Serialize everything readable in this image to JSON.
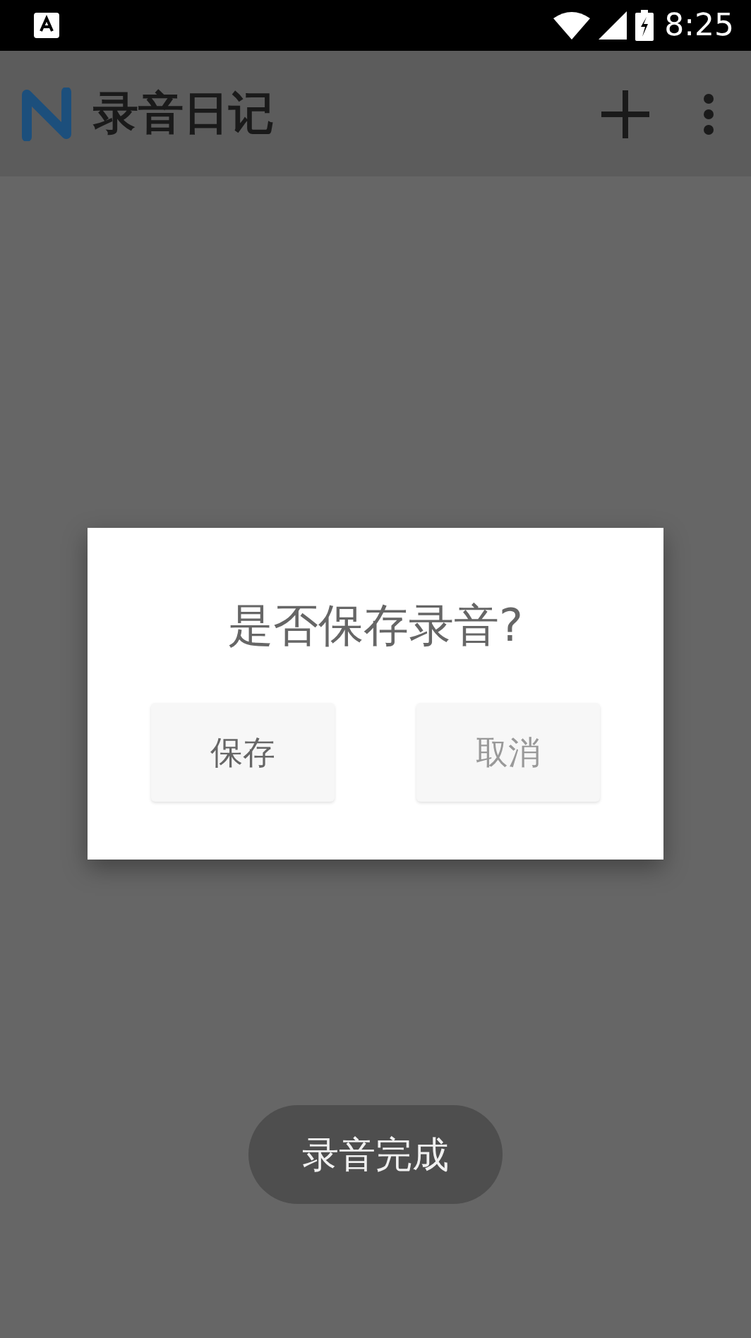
{
  "status_bar": {
    "time": "8:25"
  },
  "app_bar": {
    "title": "录音日记"
  },
  "dialog": {
    "message": "是否保存录音?",
    "buttons": [
      {
        "label": "保存",
        "kind": "primary"
      },
      {
        "label": "取消",
        "kind": "secondary"
      }
    ]
  },
  "toast": {
    "text": "录音完成"
  }
}
